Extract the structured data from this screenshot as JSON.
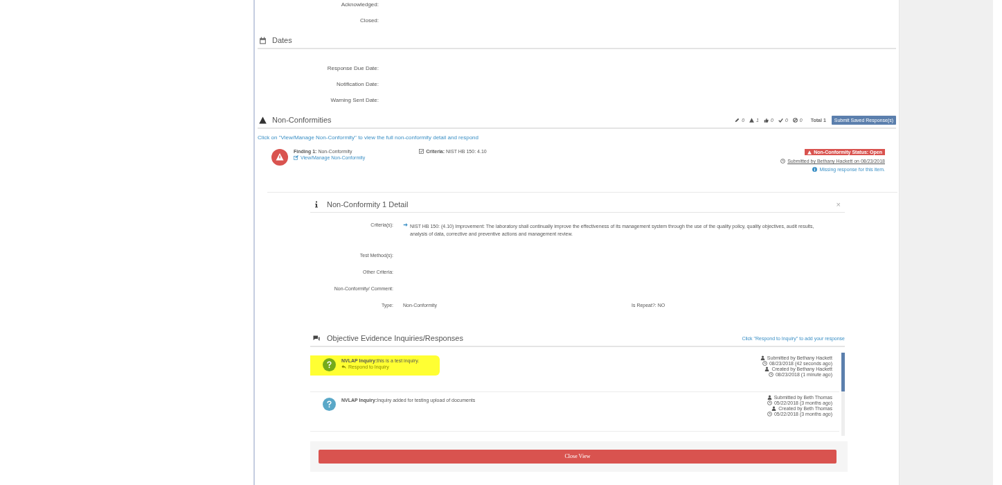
{
  "status_fields": [
    {
      "label": "Acknowledged:"
    },
    {
      "label": "Closed:"
    }
  ],
  "dates": {
    "title": "Dates",
    "fields": [
      {
        "label": "Response Due Date:"
      },
      {
        "label": "Notification Date:"
      },
      {
        "label": "Warning Sent Date:"
      }
    ]
  },
  "non_conformities": {
    "title": "Non-Conformities",
    "counters": [
      {
        "kind": "pencil",
        "count": "0"
      },
      {
        "kind": "warning",
        "count": "1"
      },
      {
        "kind": "thumbs-up",
        "count": "0"
      },
      {
        "kind": "check",
        "count": "0"
      },
      {
        "kind": "ban",
        "count": "0"
      }
    ],
    "total": "Total 1",
    "submit_button": "Submit Saved Response(s)",
    "hint": "Click on \"View/Manage Non-Conformity\" to view the full non-conformity detail and respond",
    "finding": {
      "title": "**Finding 1:** Non-Conformity",
      "link": "View/Manage Non-Conformity",
      "criteria": "**Criteria:** NIST HB 150: 4.10",
      "status_badge": "Non-Conformity Status: Open",
      "submitted": "Submitted by Bethany Hackett on 08/23/2018",
      "missing": "Missing response for this item."
    }
  },
  "detail": {
    "title": "Non-Conformity 1 Detail",
    "close": "×",
    "fields": [
      {
        "label": "Criteria(s):",
        "value": "NIST HB 150: (4.10) Improvement: The laboratory shall continually improve the effectiveness of its management system through the use of the quality policy, quality objectives, audit results, analysis of data, corrective and preventive actions and management review."
      },
      {
        "label": "Test Method(s):"
      },
      {
        "label": "Other Criteria:"
      },
      {
        "label": "Non-Conformity/ Comment:"
      },
      {
        "label": "Type:",
        "value": "Non-Conformity",
        "extra": "Is Repeat?: NO"
      }
    ]
  },
  "inquiries": {
    "title": "Objective Evidence Inquiries/Responses",
    "hint": "Click \"Respond to Inquiry\" to add your response",
    "items": [
      {
        "text": "**NVLAP Inquiry:**this is a test inquiry.",
        "respond_link": "Respond to Inquiry",
        "highlighted": true,
        "meta": [
          "Submitted by Bethany Hackett",
          "08/23/2018 (42 seconds ago)",
          "Created by Bethany Hackett",
          "08/23/2018 (1 minute ago)"
        ]
      },
      {
        "text": "**NVLAP Inquiry:**Inquiry added for testing upload of documents",
        "highlighted": false,
        "meta": [
          "Submitted by Beth Thomas",
          "05/22/2018 (3 months ago)",
          "Created by Beth Thomas",
          "05/22/2018 (3 months ago)"
        ]
      }
    ]
  },
  "close_button": "Close View"
}
